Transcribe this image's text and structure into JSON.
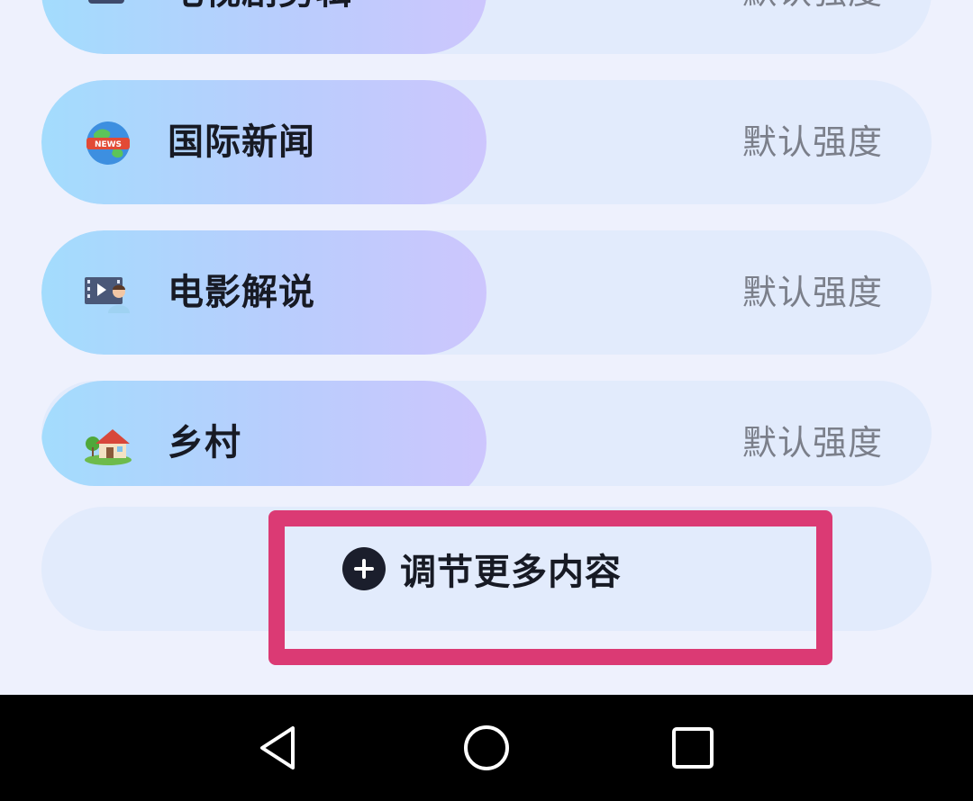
{
  "rows": [
    {
      "label": "电视剧剪辑",
      "value": "默认强度",
      "icon": "tv-series-icon"
    },
    {
      "label": "国际新闻",
      "value": "默认强度",
      "icon": "news-globe-icon"
    },
    {
      "label": "电影解说",
      "value": "默认强度",
      "icon": "movie-narration-icon"
    },
    {
      "label": "乡村",
      "value": "默认强度",
      "icon": "village-house-icon"
    }
  ],
  "more": {
    "label": "调节更多内容",
    "icon": "plus-circle-icon"
  },
  "news_icon_text": "NEWS",
  "nav": {
    "back": "back-icon",
    "home": "home-icon",
    "recents": "recents-icon"
  },
  "colors": {
    "highlight": "#db3a74",
    "pill_start": "#a3dcfd",
    "pill_end": "#cdc6fd",
    "row_bg": "#e2ebfc"
  }
}
